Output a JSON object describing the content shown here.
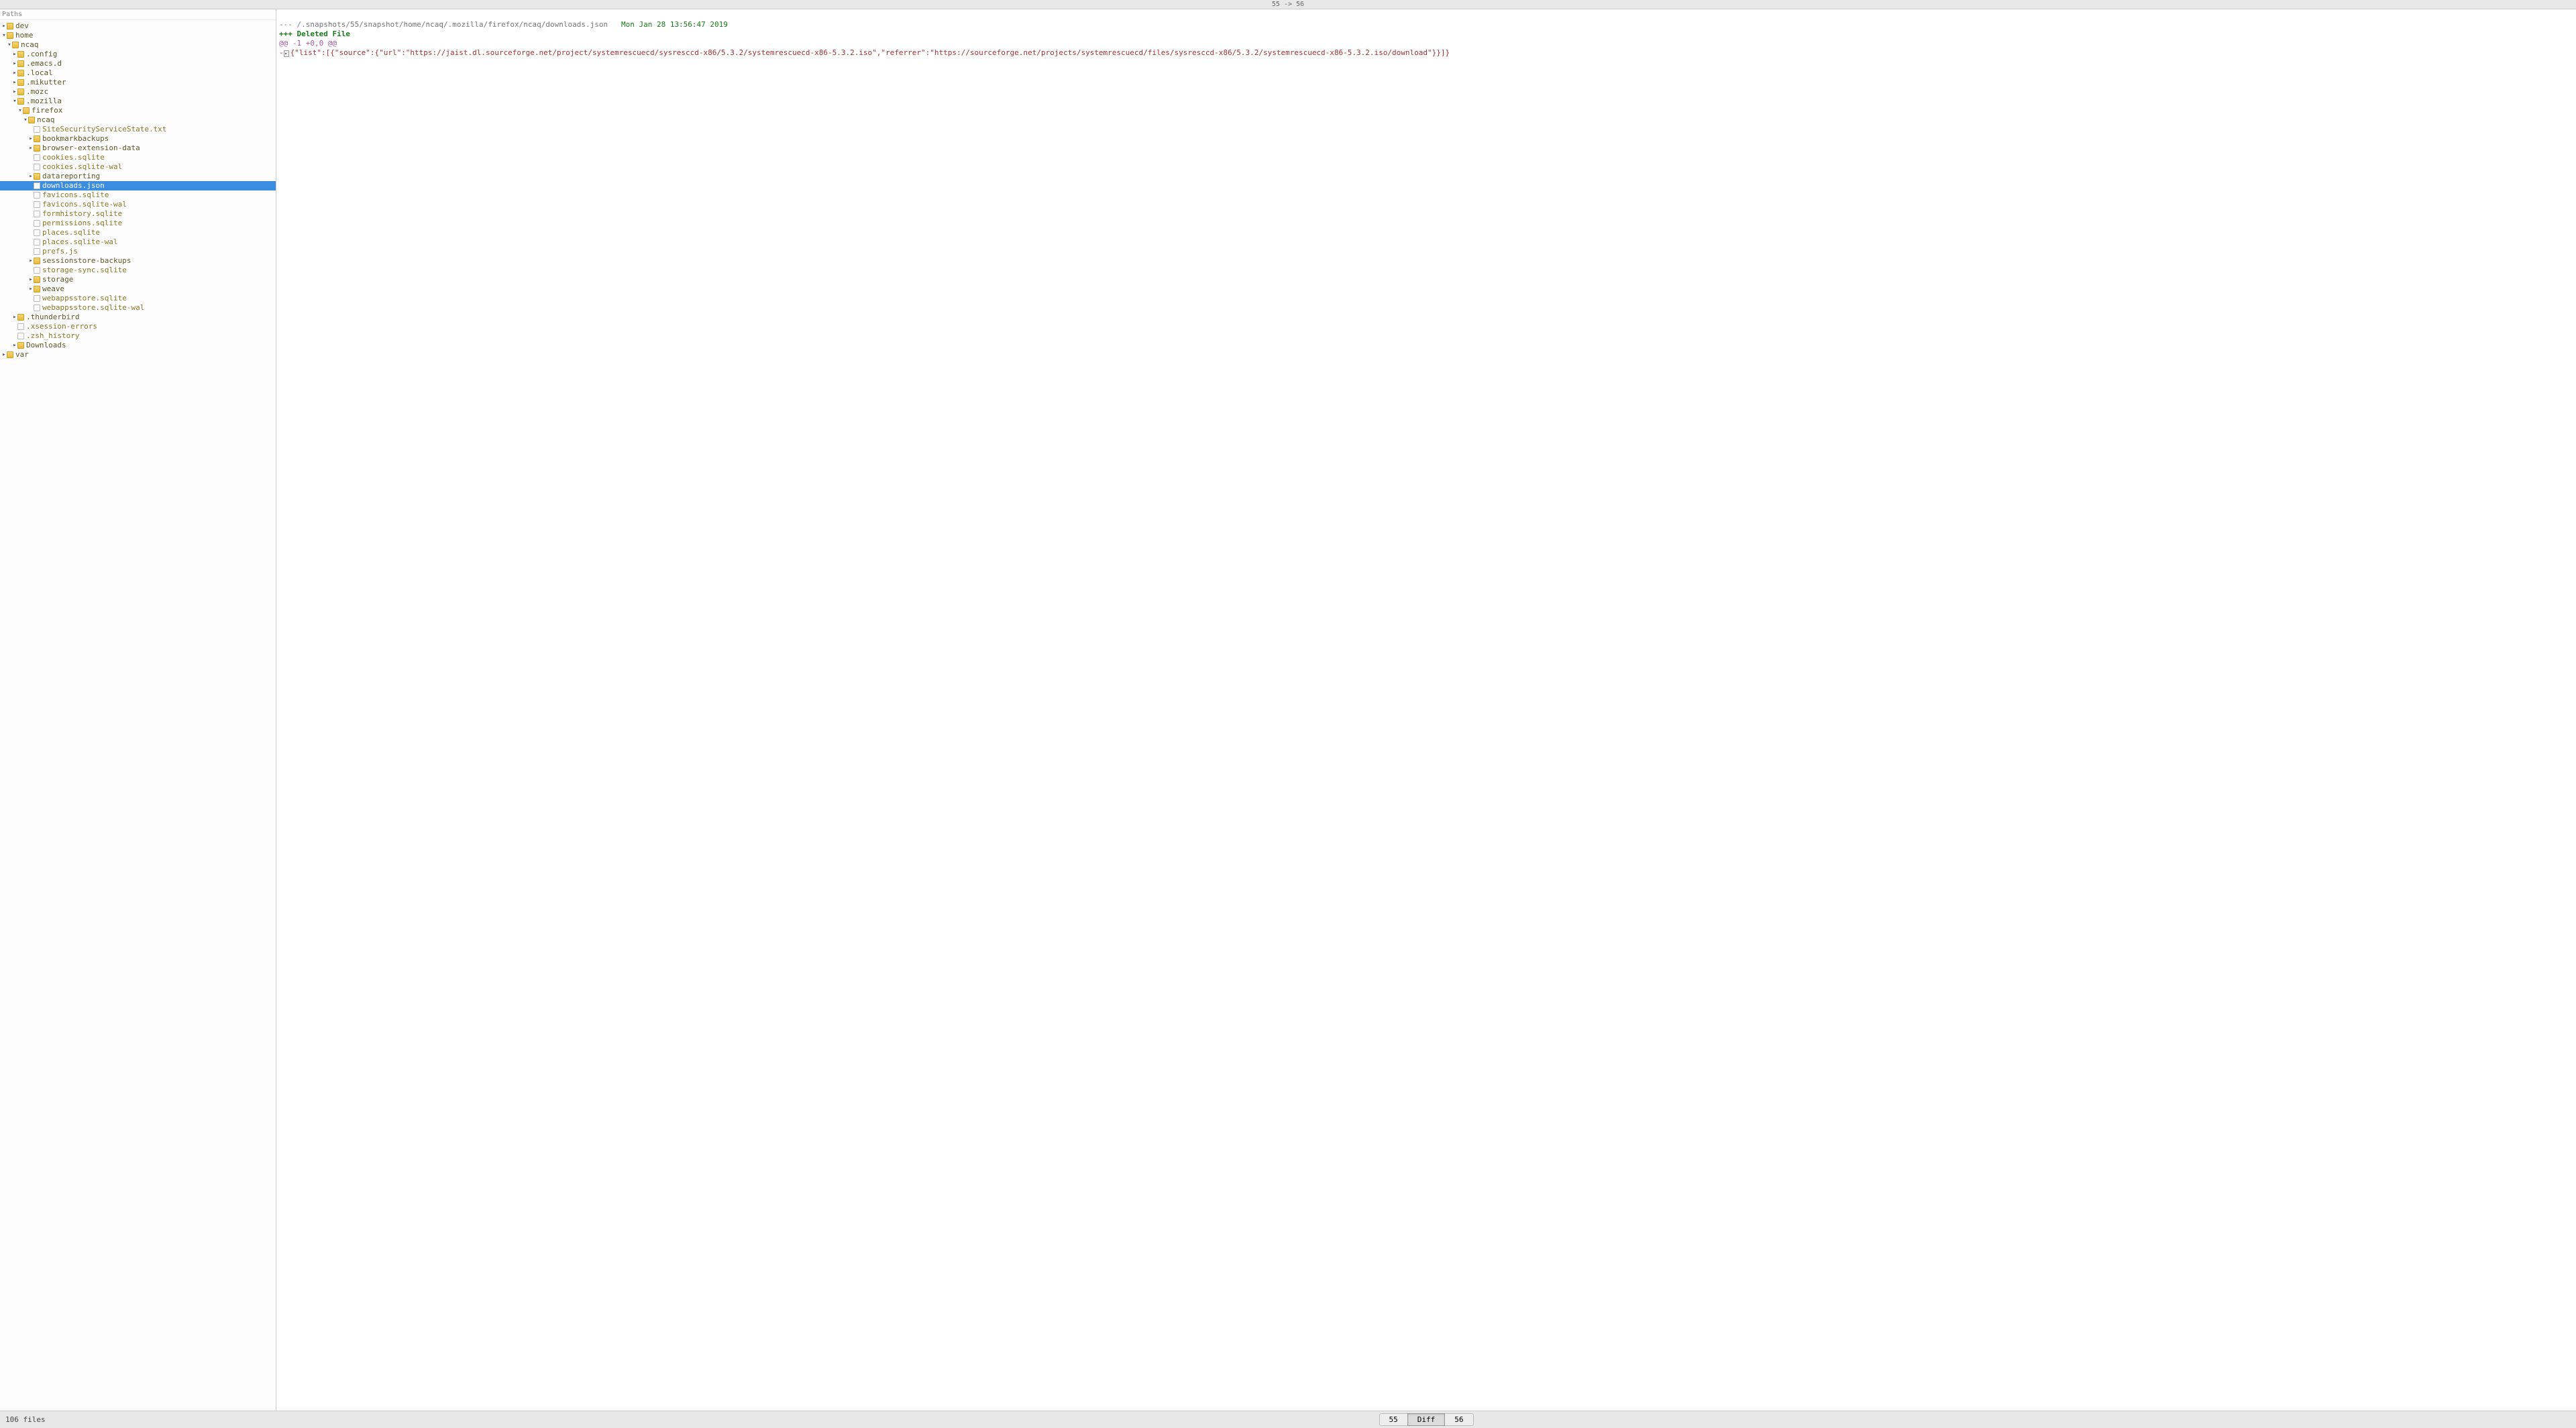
{
  "title": "55 -> 56",
  "sidebar": {
    "header": "Paths",
    "tree": [
      {
        "depth": 0,
        "arrow": "▸",
        "type": "folder",
        "label": "dev"
      },
      {
        "depth": 0,
        "arrow": "▾",
        "type": "folder",
        "label": "home"
      },
      {
        "depth": 1,
        "arrow": "▾",
        "type": "folder",
        "label": "ncaq"
      },
      {
        "depth": 2,
        "arrow": "▸",
        "type": "folder",
        "label": ".config"
      },
      {
        "depth": 2,
        "arrow": "▸",
        "type": "folder",
        "label": ".emacs.d"
      },
      {
        "depth": 2,
        "arrow": "▸",
        "type": "folder",
        "label": ".local"
      },
      {
        "depth": 2,
        "arrow": "▸",
        "type": "folder",
        "label": ".mikutter"
      },
      {
        "depth": 2,
        "arrow": "▸",
        "type": "folder",
        "label": ".mozc"
      },
      {
        "depth": 2,
        "arrow": "▾",
        "type": "folder",
        "label": ".mozilla"
      },
      {
        "depth": 3,
        "arrow": "▾",
        "type": "folder",
        "label": "firefox"
      },
      {
        "depth": 4,
        "arrow": "▾",
        "type": "folder",
        "label": "ncaq"
      },
      {
        "depth": 5,
        "arrow": "",
        "type": "file",
        "label": "SiteSecurityServiceState.txt"
      },
      {
        "depth": 5,
        "arrow": "▸",
        "type": "folder",
        "label": "bookmarkbackups"
      },
      {
        "depth": 5,
        "arrow": "▸",
        "type": "folder",
        "label": "browser-extension-data"
      },
      {
        "depth": 5,
        "arrow": "",
        "type": "file",
        "label": "cookies.sqlite"
      },
      {
        "depth": 5,
        "arrow": "",
        "type": "file",
        "label": "cookies.sqlite-wal"
      },
      {
        "depth": 5,
        "arrow": "▸",
        "type": "folder",
        "label": "datareporting"
      },
      {
        "depth": 5,
        "arrow": "",
        "type": "file",
        "label": "downloads.json",
        "selected": true
      },
      {
        "depth": 5,
        "arrow": "",
        "type": "file",
        "label": "favicons.sqlite"
      },
      {
        "depth": 5,
        "arrow": "",
        "type": "file",
        "label": "favicons.sqlite-wal"
      },
      {
        "depth": 5,
        "arrow": "",
        "type": "file",
        "label": "formhistory.sqlite"
      },
      {
        "depth": 5,
        "arrow": "",
        "type": "file",
        "label": "permissions.sqlite"
      },
      {
        "depth": 5,
        "arrow": "",
        "type": "file",
        "label": "places.sqlite"
      },
      {
        "depth": 5,
        "arrow": "",
        "type": "file",
        "label": "places.sqlite-wal"
      },
      {
        "depth": 5,
        "arrow": "",
        "type": "file",
        "label": "prefs.js"
      },
      {
        "depth": 5,
        "arrow": "▸",
        "type": "folder",
        "label": "sessionstore-backups"
      },
      {
        "depth": 5,
        "arrow": "",
        "type": "file",
        "label": "storage-sync.sqlite"
      },
      {
        "depth": 5,
        "arrow": "▸",
        "type": "folder",
        "label": "storage"
      },
      {
        "depth": 5,
        "arrow": "▸",
        "type": "folder",
        "label": "weave"
      },
      {
        "depth": 5,
        "arrow": "",
        "type": "file",
        "label": "webappsstore.sqlite"
      },
      {
        "depth": 5,
        "arrow": "",
        "type": "file",
        "label": "webappsstore.sqlite-wal"
      },
      {
        "depth": 2,
        "arrow": "▸",
        "type": "folder",
        "label": ".thunderbird"
      },
      {
        "depth": 2,
        "arrow": "",
        "type": "file",
        "label": ".xsession-errors"
      },
      {
        "depth": 2,
        "arrow": "",
        "type": "file",
        "label": ".zsh_history"
      },
      {
        "depth": 2,
        "arrow": "▸",
        "type": "folder",
        "label": "Downloads"
      },
      {
        "depth": 0,
        "arrow": "▸",
        "type": "folder",
        "label": "var"
      }
    ]
  },
  "diff": {
    "old_header_prefix": "--- ",
    "old_path": "/.snapshots/55/snapshot/home/ncaq/.mozilla/firefox/ncaq/downloads.json",
    "timestamp": "Mon Jan 28 13:56:47 2019",
    "new_header": "+++ Deleted File",
    "hunk": "@@ -1 +0,0 @@",
    "removed_line": "{\"list\":[{\"source\":{\"url\":\"https://jaist.dl.sourceforge.net/project/systemrescuecd/sysresccd-x86/5.3.2/systemrescuecd-x86-5.3.2.iso\",\"referrer\":\"https://sourceforge.net/projects/systemrescuecd/files/sysresccd-x86/5.3.2/systemrescuecd-x86-5.3.2.iso/download\"}}]}"
  },
  "status": "106 files",
  "buttons": {
    "left": "55",
    "middle": "Diff",
    "right": "56"
  }
}
